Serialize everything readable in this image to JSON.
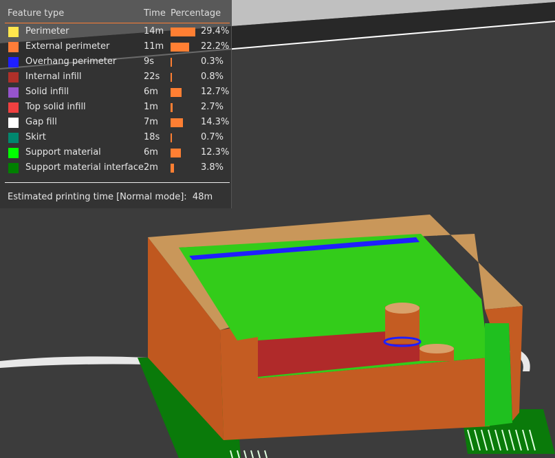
{
  "legend": {
    "header": {
      "feature": "Feature type",
      "time": "Time",
      "percentage": "Percentage"
    },
    "bar_color": "#ff7f33",
    "items": [
      {
        "label": "Perimeter",
        "color": "#ffe64d",
        "time": "14m",
        "percent": "29.4%",
        "value": 29.4
      },
      {
        "label": "External perimeter",
        "color": "#ff7d38",
        "time": "11m",
        "percent": "22.2%",
        "value": 22.2
      },
      {
        "label": "Overhang perimeter",
        "color": "#1f1fff",
        "time": "9s",
        "percent": "0.3%",
        "value": 0.3
      },
      {
        "label": "Internal infill",
        "color": "#b03029",
        "time": "22s",
        "percent": "0.8%",
        "value": 0.8
      },
      {
        "label": "Solid infill",
        "color": "#9654cc",
        "time": "6m",
        "percent": "12.7%",
        "value": 12.7
      },
      {
        "label": "Top solid infill",
        "color": "#f04040",
        "time": "1m",
        "percent": "2.7%",
        "value": 2.7
      },
      {
        "label": "Gap fill",
        "color": "#ffffff",
        "time": "7m",
        "percent": "14.3%",
        "value": 14.3
      },
      {
        "label": "Skirt",
        "color": "#00876e",
        "time": "18s",
        "percent": "0.7%",
        "value": 0.7
      },
      {
        "label": "Support material",
        "color": "#00ff00",
        "time": "6m",
        "percent": "12.3%",
        "value": 12.3
      },
      {
        "label": "Support material interface",
        "color": "#008000",
        "time": "2m",
        "percent": "3.8%",
        "value": 3.8
      }
    ],
    "estimated_label": "Estimated printing time [Normal mode]:",
    "estimated_value": "48m"
  }
}
